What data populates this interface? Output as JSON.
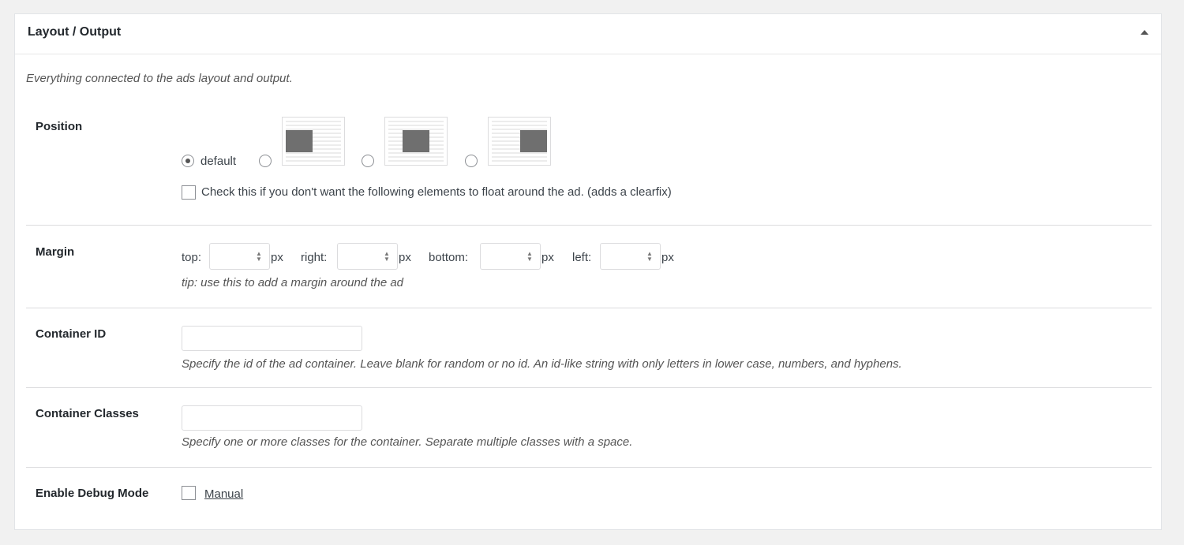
{
  "panel": {
    "title": "Layout / Output",
    "description": "Everything connected to the ads layout and output."
  },
  "position": {
    "label": "Position",
    "options": [
      {
        "label": "default",
        "checked": true
      },
      {
        "label": "",
        "checked": false,
        "icon": "float-left-thumb"
      },
      {
        "label": "",
        "checked": false,
        "icon": "center-thumb"
      },
      {
        "label": "",
        "checked": false,
        "icon": "float-right-thumb"
      }
    ],
    "clearfix_label": "Check this if you don't want the following elements to float around the ad. (adds a clearfix)",
    "clearfix_checked": false
  },
  "margin": {
    "label": "Margin",
    "fields": [
      {
        "label": "top:",
        "value": "",
        "unit": "px"
      },
      {
        "label": "right:",
        "value": "",
        "unit": "px"
      },
      {
        "label": "bottom:",
        "value": "",
        "unit": "px"
      },
      {
        "label": "left:",
        "value": "",
        "unit": "px"
      }
    ],
    "tip": "tip: use this to add a margin around the ad"
  },
  "container_id": {
    "label": "Container ID",
    "value": "",
    "hint": "Specify the id of the ad container. Leave blank for random or no id.  An id-like string with only letters in lower case, numbers, and hyphens."
  },
  "container_classes": {
    "label": "Container Classes",
    "value": "",
    "hint": "Specify one or more classes for the container. Separate multiple classes with a space."
  },
  "debug": {
    "label": "Enable Debug Mode",
    "checked": false,
    "manual_link": "Manual"
  }
}
